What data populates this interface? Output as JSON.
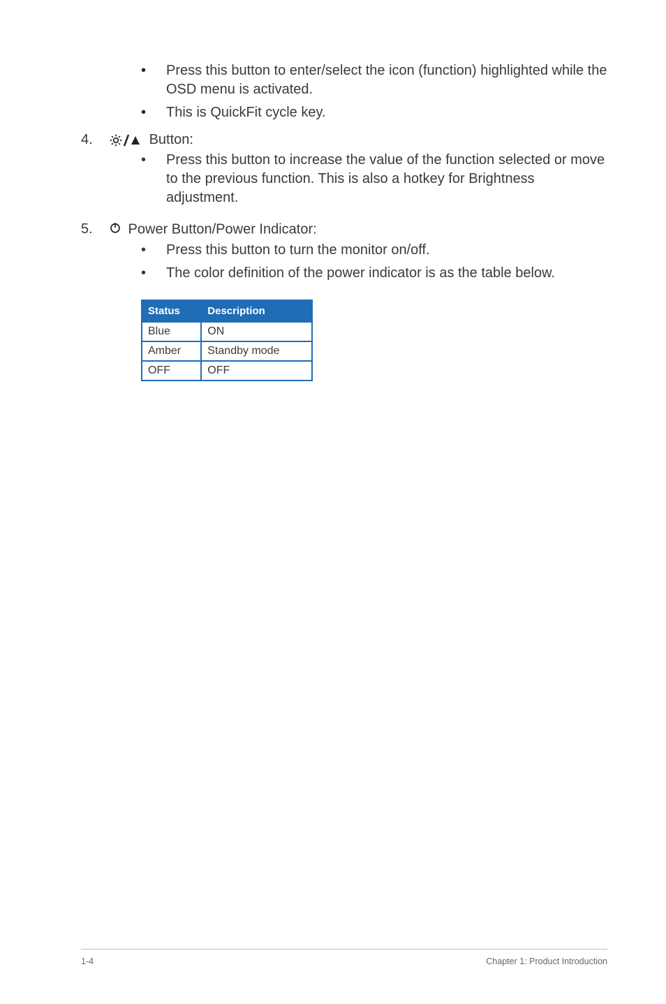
{
  "top_bullets": {
    "b1": "Press this button to enter/select the icon (function) highlighted while the OSD menu is activated.",
    "b2": "This is QuickFit cycle key."
  },
  "item4": {
    "number": "4.",
    "label": " Button:",
    "bullet": "Press this button to increase the value of the function selected or move to the previous function. This is also a hotkey for Brightness adjustment."
  },
  "item5": {
    "number": "5.",
    "label": " Power Button/Power Indicator:",
    "bullet1": "Press this button to turn the monitor on/off.",
    "bullet2": "The color definition of the power indicator is as the table below."
  },
  "table": {
    "header_status": "Status",
    "header_desc": "Description",
    "rows": [
      {
        "status": "Blue",
        "desc": "ON"
      },
      {
        "status": "Amber",
        "desc": "Standby mode"
      },
      {
        "status": "OFF",
        "desc": "OFF"
      }
    ]
  },
  "footer": {
    "left": "1-4",
    "right": "Chapter 1: Product Introduction"
  }
}
